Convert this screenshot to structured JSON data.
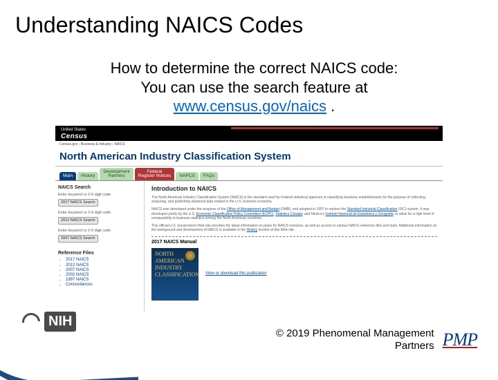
{
  "title": "Understanding NAICS Codes",
  "intro": {
    "line1": "How to determine the correct NAICS code:",
    "line2": "You can use the search feature at",
    "link": "www.census.gov/naics",
    "period": " ."
  },
  "screenshot": {
    "topbar_small": "United States",
    "topbar_logo": "Census",
    "crumb": "Census.gov › Business & Industry › NAICS",
    "heading": "North American Industry Classification System",
    "tabs": {
      "main": "Main",
      "history": "History",
      "dev": "Development\nPartners",
      "fed": "Federal\nRegister Notices",
      "updates": "NAPCS",
      "faq": "FAQs"
    },
    "search": {
      "title": "NAICS Search",
      "hint1": "Enter keyword or 2-6 digit code",
      "btn1": "2017 NAICS Search",
      "hint2": "Enter keyword or 2-6 digit code",
      "btn2": "2012 NAICS Search",
      "hint3": "Enter keyword or 2-6 digit code",
      "btn3": "2007 NAICS Search"
    },
    "ref": {
      "title": "Reference Files",
      "items": [
        "2017 NAICS",
        "2012 NAICS",
        "2007 NAICS",
        "2002 NAICS",
        "1997 NAICS",
        "Concordances"
      ]
    },
    "body": {
      "heading": "Introduction to NAICS",
      "p1a": "The North American Industry Classification System (NAICS) is the standard used by Federal statistical agencies in classifying business establishments for the purpose of collecting, analyzing, and publishing statistical data related to the U.S. business economy.",
      "p2a": "NAICS was developed under the auspices of the ",
      "p2link1": "Office of Management and Budget",
      "p2b": " (OMB), and adopted in 1997 to replace the ",
      "p2link2": "Standard Industrial Classification",
      "p2c": " (SIC) system. It was developed jointly by the U.S. ",
      "p2link3": "Economic Classification Policy Committee (ECPC)",
      "p2d": ", ",
      "p2link4": "Statistics Canada",
      "p2e": ", and Mexico's ",
      "p2link5": "Instituto Nacional de Estadistica y Geografia",
      "p2f": ", to allow for a high level of comparability in business statistics among the North American countries.",
      "p3a": "This official U.S. Government Web site provides the latest information on plans for NAICS revisions, as well as access to various NAICS reference files and tools. Additional information on the background and development of NAICS is available in the ",
      "p3link": "History",
      "p3b": " section of this Web site.",
      "manual_title": "2017 NAICS Manual",
      "cover_l1": "NORTH",
      "cover_l2": "AMERICAN",
      "cover_l3": "INDUSTRY",
      "cover_l4": "CLASSIFICATION",
      "manual_link": "View or download this publication"
    }
  },
  "nih": "NIH",
  "footer": {
    "copy_l1": "© 2019 Phenomenal Management",
    "copy_l2": "Partners",
    "pmp": "PMP"
  }
}
